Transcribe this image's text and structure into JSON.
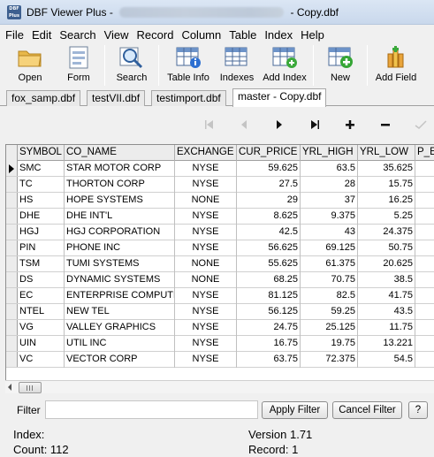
{
  "window": {
    "app_name": "DBF Viewer Plus",
    "title_separator": "-",
    "file_suffix": "- Copy.dbf",
    "icon_label": "DBF Plus"
  },
  "menu": [
    "File",
    "Edit",
    "Search",
    "View",
    "Record",
    "Column",
    "Table",
    "Index",
    "Help"
  ],
  "toolbar": {
    "open": "Open",
    "form": "Form",
    "search": "Search",
    "table_info": "Table Info",
    "indexes": "Indexes",
    "add_index": "Add Index",
    "new": "New",
    "add_field": "Add Field"
  },
  "tabs": [
    {
      "label": "fox_samp.dbf"
    },
    {
      "label": "testVII.dbf"
    },
    {
      "label": "testimport.dbf"
    },
    {
      "label": "master - Copy.dbf",
      "active": true
    }
  ],
  "grid": {
    "columns": [
      "SYMBOL",
      "CO_NAME",
      "EXCHANGE",
      "CUR_PRICE",
      "YRL_HIGH",
      "YRL_LOW",
      "P_E"
    ],
    "rows": [
      [
        "SMC",
        "STAR MOTOR CORP",
        "NYSE",
        "59.625",
        "63.5",
        "35.625"
      ],
      [
        "TC",
        "THORTON CORP",
        "NYSE",
        "27.5",
        "28",
        "15.75"
      ],
      [
        "HS",
        "HOPE SYSTEMS",
        "NONE",
        "29",
        "37",
        "16.25"
      ],
      [
        "DHE",
        "DHE INT'L",
        "NYSE",
        "8.625",
        "9.375",
        "5.25"
      ],
      [
        "HGJ",
        "HGJ CORPORATION",
        "NYSE",
        "42.5",
        "43",
        "24.375"
      ],
      [
        "PIN",
        "PHONE INC",
        "NYSE",
        "56.625",
        "69.125",
        "50.75"
      ],
      [
        "TSM",
        "TUMI SYSTEMS",
        "NONE",
        "55.625",
        "61.375",
        "20.625"
      ],
      [
        "DS",
        "DYNAMIC SYSTEMS",
        "NONE",
        "68.25",
        "70.75",
        "38.5"
      ],
      [
        "EC",
        "ENTERPRISE COMPUTER",
        "NYSE",
        "81.125",
        "82.5",
        "41.75"
      ],
      [
        "NTEL",
        "NEW TEL",
        "NYSE",
        "56.125",
        "59.25",
        "43.5"
      ],
      [
        "VG",
        "VALLEY GRAPHICS",
        "NYSE",
        "24.75",
        "25.125",
        "11.75"
      ],
      [
        "UIN",
        "UTIL INC",
        "NYSE",
        "16.75",
        "19.75",
        "13.221"
      ],
      [
        "VC",
        "VECTOR CORP",
        "NYSE",
        "63.75",
        "72.375",
        "54.5"
      ]
    ]
  },
  "filter": {
    "label": "Filter",
    "value": "",
    "apply": "Apply Filter",
    "cancel": "Cancel Filter",
    "help": "?"
  },
  "status": {
    "index": "Index:",
    "count": "Count: 112",
    "version": "Version 1.71",
    "record": "Record: 1"
  }
}
